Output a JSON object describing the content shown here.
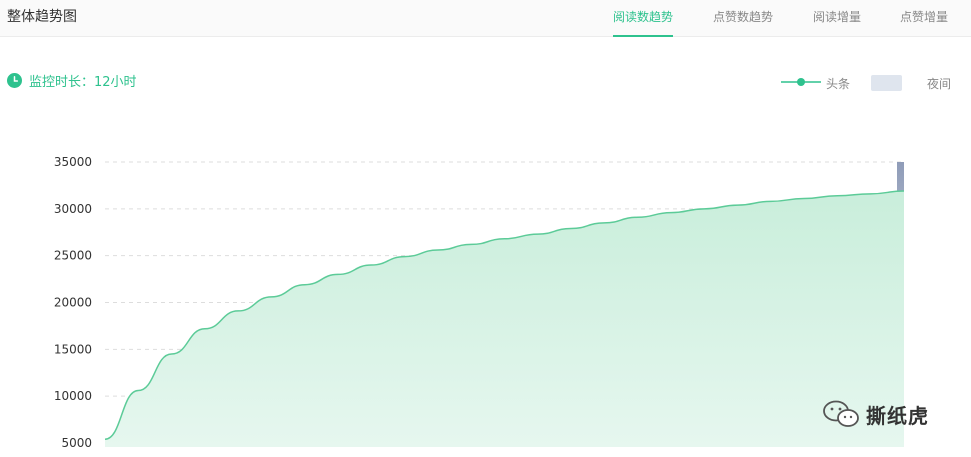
{
  "header": {
    "title": "整体趋势图",
    "tabs": [
      {
        "label": "阅读数趋势",
        "active": true
      },
      {
        "label": "点赞数趋势",
        "active": false
      },
      {
        "label": "阅读增量",
        "active": false
      },
      {
        "label": "点赞增量",
        "active": false
      }
    ]
  },
  "monitor": {
    "label": "监控时长：12小时",
    "icon": "clock-icon"
  },
  "legend": [
    {
      "label": "头条",
      "marker": "line-dot",
      "color": "#2ec28e"
    },
    {
      "label": "夜间",
      "marker": "swatch",
      "color": "#dfe5ee"
    }
  ],
  "watermark": {
    "text": "撕纸虎",
    "icon": "wechat-icon"
  },
  "colors": {
    "accent": "#2ec28e",
    "area_fill": "#d9f3e6",
    "grid": "#dddddd",
    "night_bar": "#8f9cb8"
  },
  "chart_data": {
    "type": "area",
    "y_ticks": [
      "35000",
      "30000",
      "25000",
      "20000",
      "15000",
      "10000",
      "5000"
    ],
    "ylim": [
      5000,
      35000
    ],
    "grid": true,
    "legend_placement": "top-right",
    "series": [
      {
        "name": "头条",
        "values": [
          5400,
          10600,
          14500,
          17200,
          19100,
          20600,
          21900,
          23000,
          24000,
          24900,
          25600,
          26200,
          26800,
          27300,
          27900,
          28500,
          29100,
          29600,
          30000,
          30400,
          30800,
          31100,
          31400,
          31600,
          31900
        ]
      }
    ]
  }
}
